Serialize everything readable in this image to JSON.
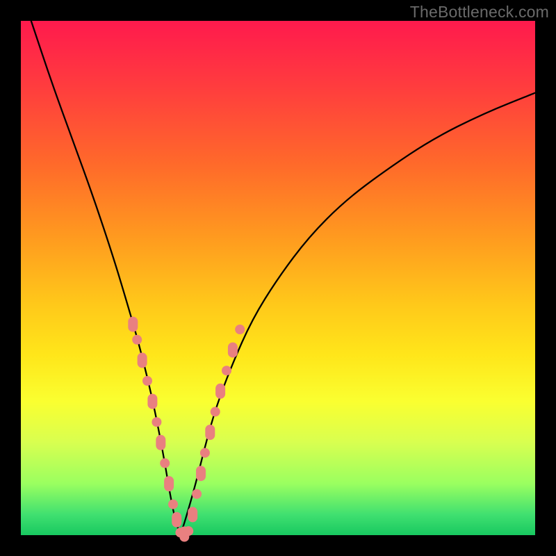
{
  "watermark": "TheBottleneck.com",
  "chart_data": {
    "type": "line",
    "title": "",
    "xlabel": "",
    "ylabel": "",
    "xlim": [
      0,
      100
    ],
    "ylim": [
      0,
      100
    ],
    "series": [
      {
        "name": "bottleneck-curve",
        "x": [
          2,
          6,
          10,
          14,
          18,
          21,
          23,
          25,
          26.5,
          28,
          29,
          30,
          31,
          32,
          34,
          36,
          38,
          41,
          45,
          50,
          56,
          63,
          71,
          80,
          90,
          100
        ],
        "y": [
          100,
          88,
          77,
          66,
          54,
          44,
          37,
          29,
          22,
          14,
          8,
          3,
          0,
          3,
          10,
          18,
          25,
          33,
          42,
          50,
          58,
          65,
          71,
          77,
          82,
          86
        ]
      }
    ],
    "markers": {
      "name": "highlight-beads",
      "left_arm": [
        {
          "x": 21.8,
          "y": 41
        },
        {
          "x": 22.6,
          "y": 38
        },
        {
          "x": 23.6,
          "y": 34
        },
        {
          "x": 24.6,
          "y": 30
        },
        {
          "x": 25.6,
          "y": 26
        },
        {
          "x": 26.4,
          "y": 22
        },
        {
          "x": 27.2,
          "y": 18
        },
        {
          "x": 28.0,
          "y": 14
        },
        {
          "x": 28.8,
          "y": 10
        },
        {
          "x": 29.6,
          "y": 6
        },
        {
          "x": 30.3,
          "y": 3
        }
      ],
      "trough": [
        {
          "x": 31.0,
          "y": 0.5
        },
        {
          "x": 31.8,
          "y": 0.2
        },
        {
          "x": 32.6,
          "y": 0.8
        }
      ],
      "right_arm": [
        {
          "x": 33.4,
          "y": 4
        },
        {
          "x": 34.2,
          "y": 8
        },
        {
          "x": 35.0,
          "y": 12
        },
        {
          "x": 35.8,
          "y": 16
        },
        {
          "x": 36.8,
          "y": 20
        },
        {
          "x": 37.8,
          "y": 24
        },
        {
          "x": 38.8,
          "y": 28
        },
        {
          "x": 40.0,
          "y": 32
        },
        {
          "x": 41.2,
          "y": 36
        },
        {
          "x": 42.6,
          "y": 40
        }
      ]
    },
    "gradient_bands": [
      {
        "color": "#ff1a4d",
        "pos": 0
      },
      {
        "color": "#ff9a1f",
        "pos": 42
      },
      {
        "color": "#ffe61a",
        "pos": 65
      },
      {
        "color": "#9aff60",
        "pos": 90
      },
      {
        "color": "#18c860",
        "pos": 100
      }
    ]
  }
}
